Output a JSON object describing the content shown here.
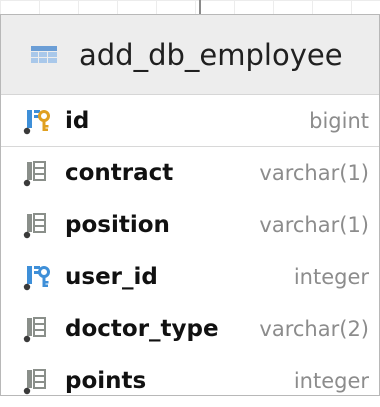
{
  "table": {
    "name": "add_db_employee",
    "columns": [
      {
        "name": "id",
        "type": "bigint",
        "icon": "primary-key-column-icon"
      },
      {
        "name": "contract",
        "type": "varchar(1)",
        "icon": "column-icon"
      },
      {
        "name": "position",
        "type": "varchar(1)",
        "icon": "column-icon"
      },
      {
        "name": "user_id",
        "type": "integer",
        "icon": "foreign-key-column-icon"
      },
      {
        "name": "doctor_type",
        "type": "varchar(2)",
        "icon": "column-icon"
      },
      {
        "name": "points",
        "type": "integer",
        "icon": "column-icon"
      }
    ]
  },
  "colors": {
    "header_bg": "#ededed",
    "column_icon": "#8a8f8a",
    "key_gold": "#e0a020",
    "key_blue": "#3e8fd8",
    "type_text": "#8c8c8c"
  }
}
